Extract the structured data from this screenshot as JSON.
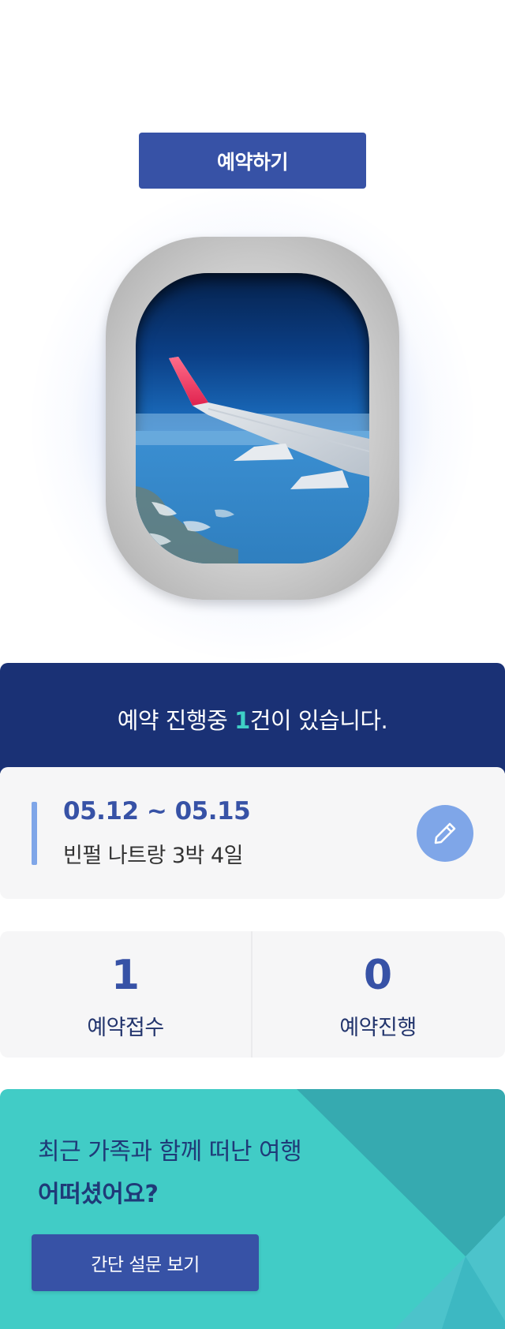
{
  "reserve_button": {
    "label": "예약하기"
  },
  "status": {
    "prefix": "예약 진행중 ",
    "count": "1",
    "suffix": "건이 있습니다."
  },
  "trip": {
    "dates": "05.12 ~ 05.15",
    "name": "빈펄 나트랑 3박 4일",
    "edit_icon": "pencil-icon"
  },
  "stats": [
    {
      "value": "1",
      "label": "예약접수"
    },
    {
      "value": "0",
      "label": "예약진행"
    }
  ],
  "promo": {
    "line1": "최근 가족과 함께 떠난 여행",
    "line2": "어떠셨어요?",
    "button_label": "간단 설문 보기"
  },
  "colors": {
    "primary": "#3752a6",
    "navy": "#1a3175",
    "teal": "#41ccc6",
    "accent_count": "#3fd0c6",
    "soft_blue": "#7fa6e8"
  }
}
